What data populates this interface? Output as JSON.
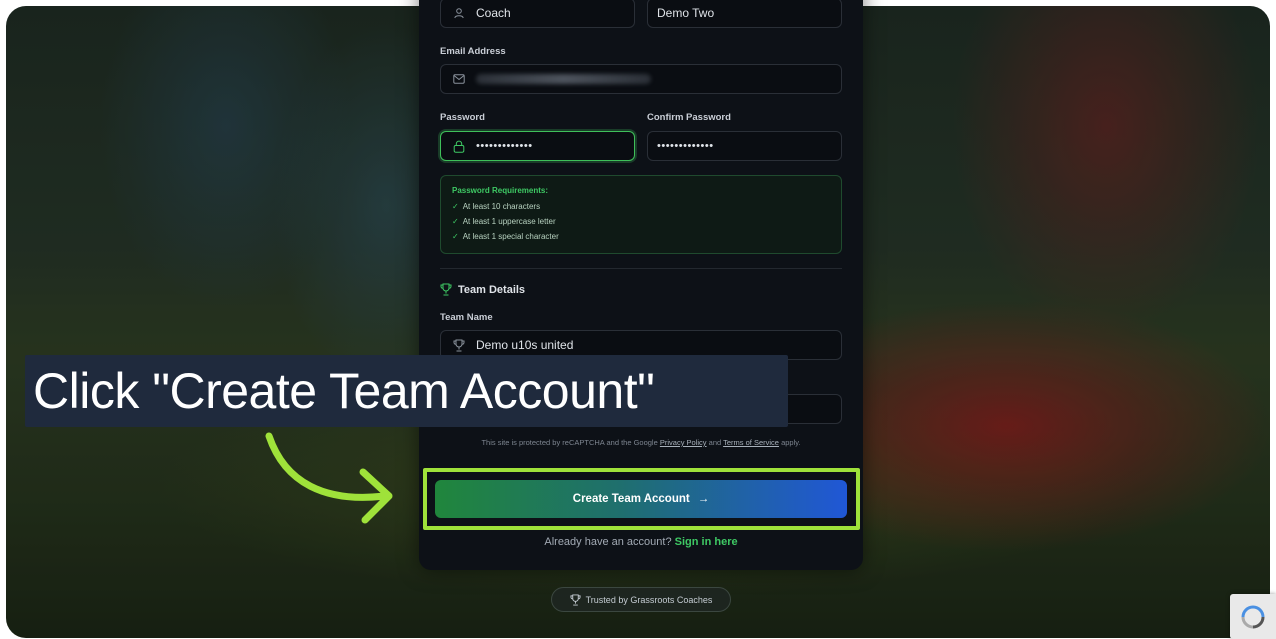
{
  "form": {
    "role_value": "Coach",
    "name_value": "Demo Two",
    "email_label": "Email Address",
    "password_label": "Password",
    "confirm_password_label": "Confirm Password",
    "password_mask": "•••••••••••••",
    "confirm_password_mask": "•••••••••••••",
    "requirements": {
      "title": "Password Requirements:",
      "check_glyph": "✓",
      "items": [
        "At least 10 characters",
        "At least 1 uppercase letter",
        "At least 1 special character"
      ]
    },
    "team_section_title": "Team Details",
    "team_name_label": "Team Name",
    "team_name_value": "Demo u10s united",
    "recaptcha_prefix": "This site is protected by reCAPTCHA and the Google",
    "privacy_link": "Privacy Policy",
    "recaptcha_and": "and",
    "terms_link": "Terms of Service",
    "recaptcha_suffix": "apply.",
    "submit_label": "Create Team Account",
    "submit_arrow": "→",
    "signin_prompt": "Already have an account?",
    "signin_link": "Sign in here"
  },
  "trusted_badge": "Trusted by Grassroots Coaches",
  "callout": {
    "text": "Click \"Create Team Account\""
  },
  "icons": [
    "user-icon",
    "mail-icon",
    "lock-icon",
    "trophy-icon",
    "arrow-right-icon",
    "curved-arrow-icon",
    "recaptcha-logo-icon"
  ],
  "colors": {
    "accent_green": "#3ec964",
    "highlight": "#9fe23a",
    "card_bg": "#0d1117",
    "callout_bg": "#1f2a3d",
    "cta_start": "#20863c",
    "cta_end": "#2057d6"
  }
}
